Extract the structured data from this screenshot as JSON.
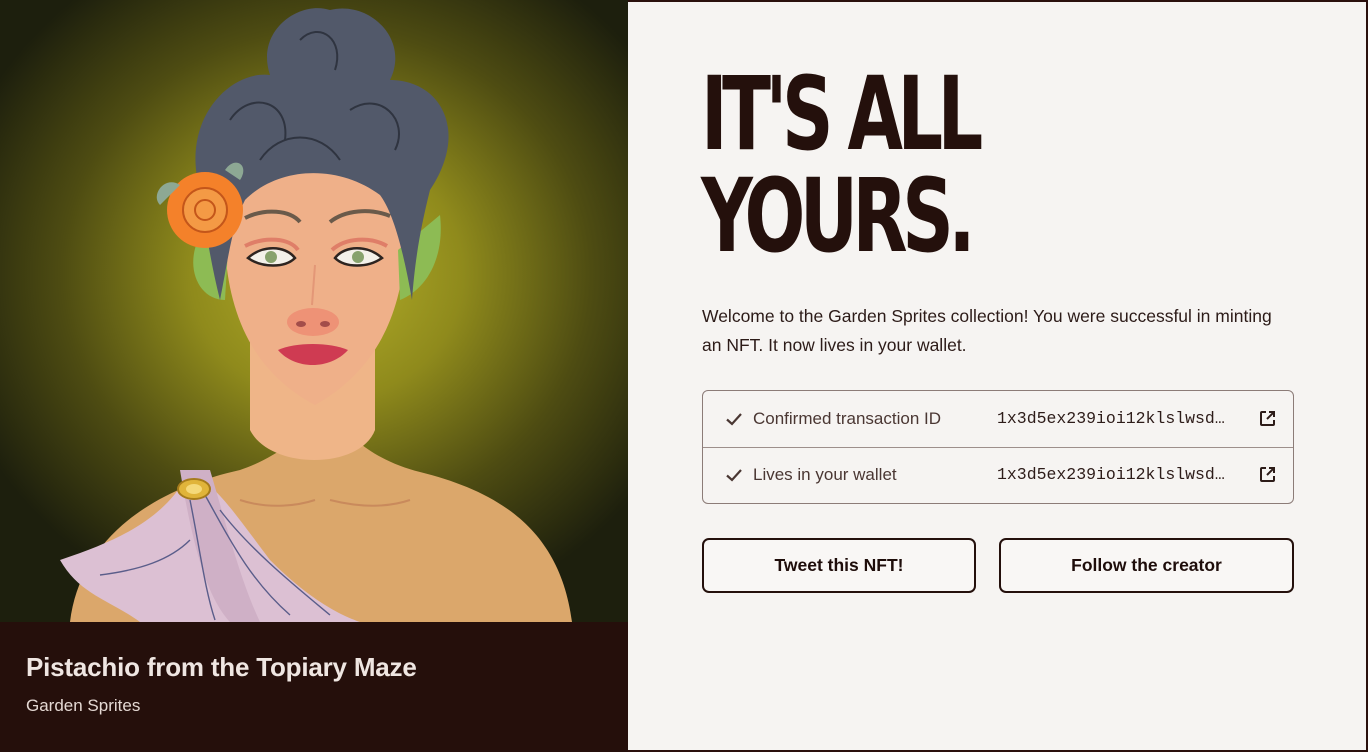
{
  "nft": {
    "name": "Pistachio from the Topiary Maze",
    "collection": "Garden Sprites"
  },
  "headline": {
    "line1": "IT'S ALL",
    "line2": "YOURS."
  },
  "welcome_text": "Welcome to the Garden Sprites collection! You were successful in minting an NFT. It now lives in your wallet.",
  "transactions": [
    {
      "label": "Confirmed transaction ID",
      "value": "1x3d5ex239ioi12klslwsd…",
      "icon": "check-icon",
      "action_icon": "external-link-icon"
    },
    {
      "label": "Lives in your wallet",
      "value": "1x3d5ex239ioi12klslwsd…",
      "icon": "check-icon",
      "action_icon": "external-link-icon"
    }
  ],
  "buttons": {
    "tweet": "Tweet this NFT!",
    "follow": "Follow the creator"
  },
  "colors": {
    "dark_brown": "#24100c",
    "panel_bg": "#f6f4f2",
    "art_glow": "#b5b02a"
  }
}
